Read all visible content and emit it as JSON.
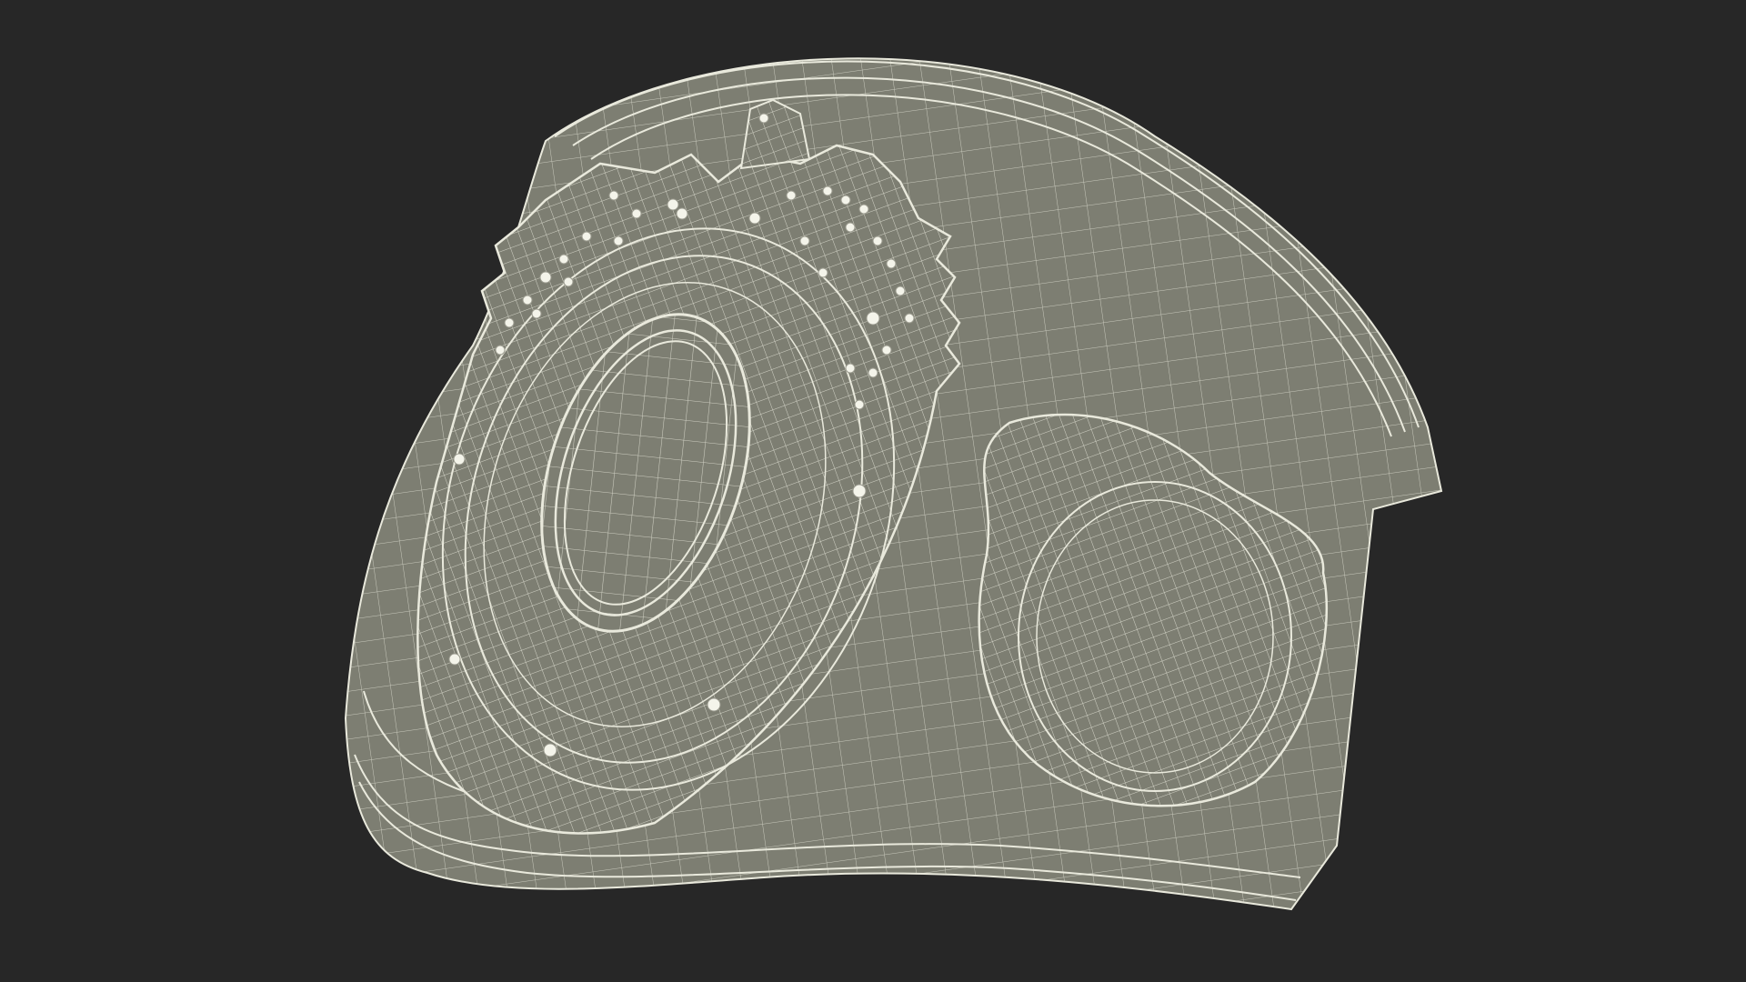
{
  "scene": {
    "background_color": "#272727",
    "surface_color": "#7d7e72",
    "surface_shade_color": "#6b6c62",
    "wireframe_color": "#e9e9dc",
    "stud_color": "#f4f4ea"
  }
}
